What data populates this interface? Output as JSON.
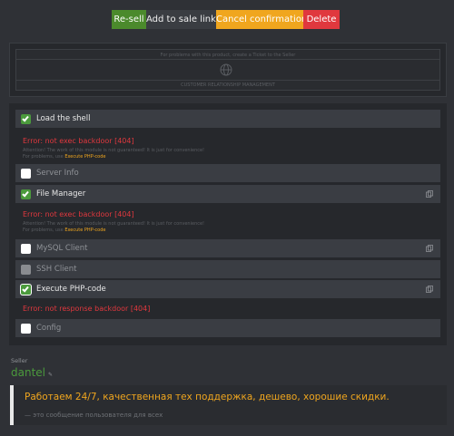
{
  "actions": {
    "resell": "Re-sell",
    "add_links": "Add to sale links",
    "cancel": "Cancel confirmation",
    "delete": "Delete"
  },
  "ticket": {
    "top_text": "For problems with this product, create a Ticket to the Seller",
    "bottom_text": "CUSTOMER RELATIONSHIP MANAGEMENT",
    "icon": "globe-icon"
  },
  "modules": {
    "load_shell": {
      "label": "Load the shell",
      "checked": true
    },
    "err1": "Error: not exec backdoor [404]",
    "note1a": "Attention! The work of this module is not guaranteed! It is just for convenience!",
    "note1b_prefix": "For problems, use ",
    "note1b_link": "Execute PHP-code",
    "server_info": {
      "label": "Server Info",
      "checked": false
    },
    "file_manager": {
      "label": "File Manager",
      "checked": true
    },
    "err2": "Error: not exec backdoor [404]",
    "note2a": "Attention! The work of this module is not guaranteed! It is just for convenience!",
    "note2b_prefix": "For problems, use ",
    "note2b_link": "Execute PHP-code",
    "mysql_client": {
      "label": "MySQL Client",
      "checked": false
    },
    "ssh_client": {
      "label": "SSH Client",
      "checked": false,
      "disabled": true
    },
    "exec_php": {
      "label": "Execute PHP-code",
      "checked": true
    },
    "err3": "Error: not response backdoor [404]",
    "config": {
      "label": "Config",
      "checked": false
    }
  },
  "seller": {
    "label": "Seller",
    "name": "dantel",
    "edit_icon": "pencil-icon"
  },
  "quote": {
    "text": "Работаем 24/7, качественная тех поддержка, дешево, хорошие скидки.",
    "sub": "— это сообщение пользователя для всех"
  },
  "colors": {
    "green": "#4b8a2c",
    "orange": "#f0a61e",
    "red": "#e0383e",
    "background": "#2f3136"
  }
}
